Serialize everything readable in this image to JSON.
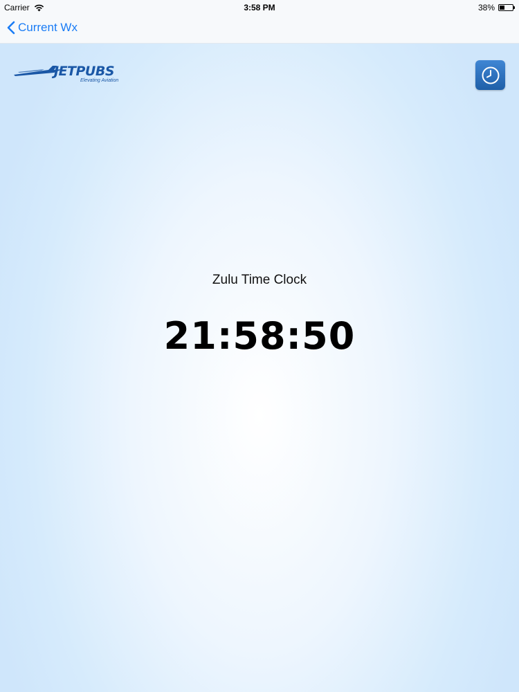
{
  "status_bar": {
    "carrier": "Carrier",
    "time": "3:58 PM",
    "battery_percent_label": "38%",
    "battery_level": 0.38,
    "wifi_icon": "wifi-icon",
    "battery_icon": "battery-icon"
  },
  "nav": {
    "back_label": "Current Wx",
    "back_icon": "chevron-left-icon"
  },
  "logo": {
    "name": "JETPUBS",
    "tagline": "Elevating Aviation",
    "color": "#1a57a6"
  },
  "clock_button": {
    "icon": "clock-icon",
    "color": "#2a6fbf"
  },
  "clock": {
    "title": "Zulu Time Clock",
    "time": "21:58:50"
  },
  "colors": {
    "accent": "#1a7cf5",
    "background_edge": "#cfe6fb",
    "background_center": "#ffffff"
  }
}
